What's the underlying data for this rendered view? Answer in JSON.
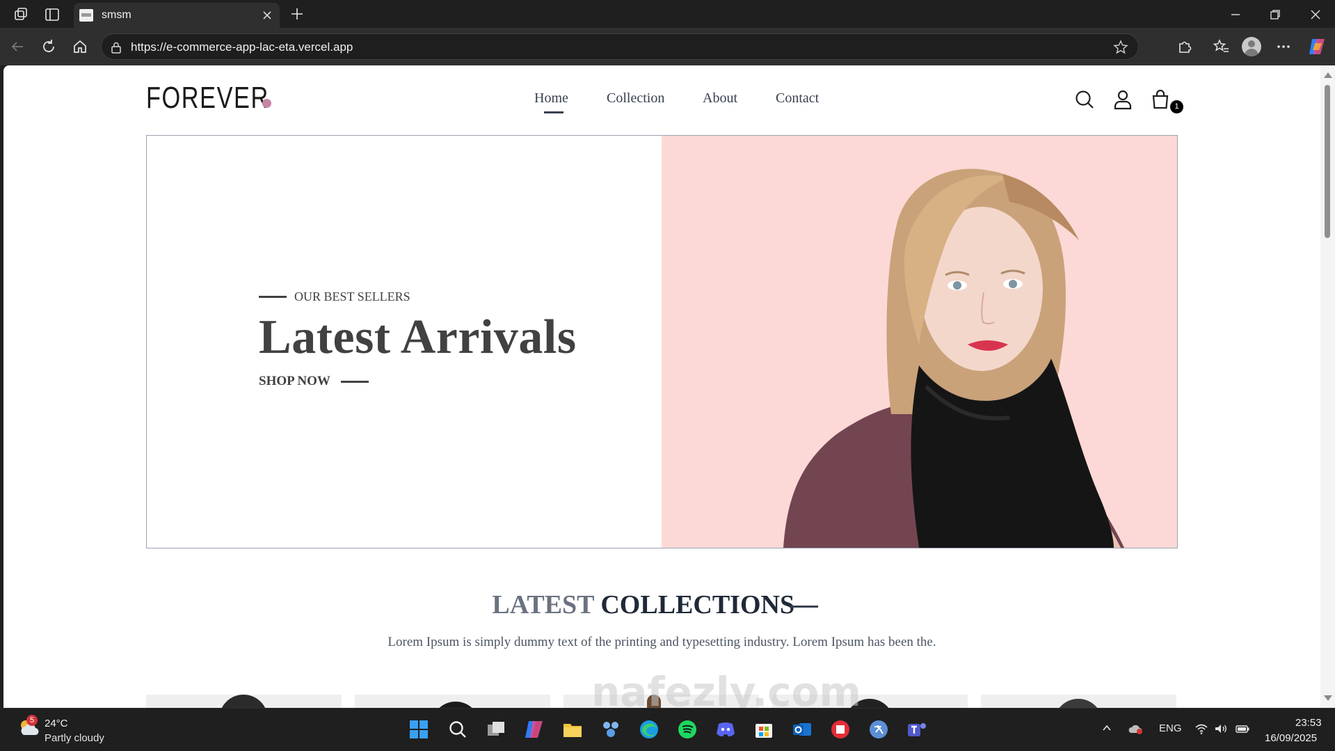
{
  "browser": {
    "tab_title": "smsm",
    "url": "https://e-commerce-app-lac-eta.vercel.app"
  },
  "site": {
    "logo_text": "FOREVER",
    "accent_color": "#c586a5",
    "nav": [
      {
        "label": "Home",
        "active": true
      },
      {
        "label": "Collection",
        "active": false
      },
      {
        "label": "About",
        "active": false
      },
      {
        "label": "Contact",
        "active": false
      }
    ],
    "cart_count": "1",
    "icons": [
      "search-icon",
      "profile-icon",
      "shopping-bag-icon"
    ]
  },
  "hero": {
    "eyebrow": "OUR BEST SELLERS",
    "title": "Latest Arrivals",
    "cta": "SHOP NOW",
    "image_bg": "#fcd9d6"
  },
  "collections": {
    "title_light": "LATEST",
    "title_dark": "COLLECTIONS",
    "description": "Lorem Ipsum is simply dummy text of the printing and typesetting industry. Lorem Ipsum has been the."
  },
  "watermark": "nafezly.com",
  "taskbar": {
    "weather_badge": "5",
    "temperature": "24°C",
    "condition": "Partly cloudy",
    "language": "ENG",
    "time": "23:53",
    "date": "16/09/2025"
  }
}
